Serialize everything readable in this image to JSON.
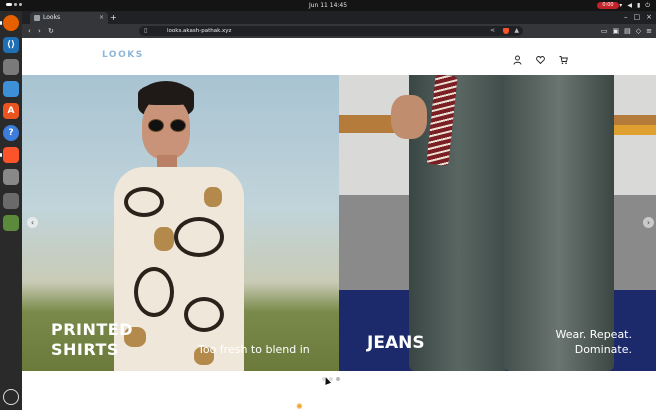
{
  "system": {
    "clock": "Jun 11  14:45",
    "recording_badge": "0:00"
  },
  "browser": {
    "tab_title": "Looks",
    "tab_close": "×",
    "new_tab": "+",
    "url": "looks.akash-pathak.xyz",
    "win_minimize": "–",
    "win_maximize": "□",
    "win_close": "×"
  },
  "site": {
    "logo": "LOOKS",
    "hero": {
      "left_title_line1": "PRINTED",
      "left_title_line2": "SHIRTS",
      "left_subtitle": "Too fresh to blend in",
      "right_title": "JEANS",
      "right_subtitle_line1": "Wear. Repeat.",
      "right_subtitle_line2": "Dominate.",
      "prev_arrow": "‹",
      "next_arrow": "›"
    },
    "carousel_dots": 3,
    "active_dot": 2
  },
  "colors": {
    "logo": "#8fb6d8",
    "record": "#c0232a",
    "brave_shield": "#fb542b"
  }
}
